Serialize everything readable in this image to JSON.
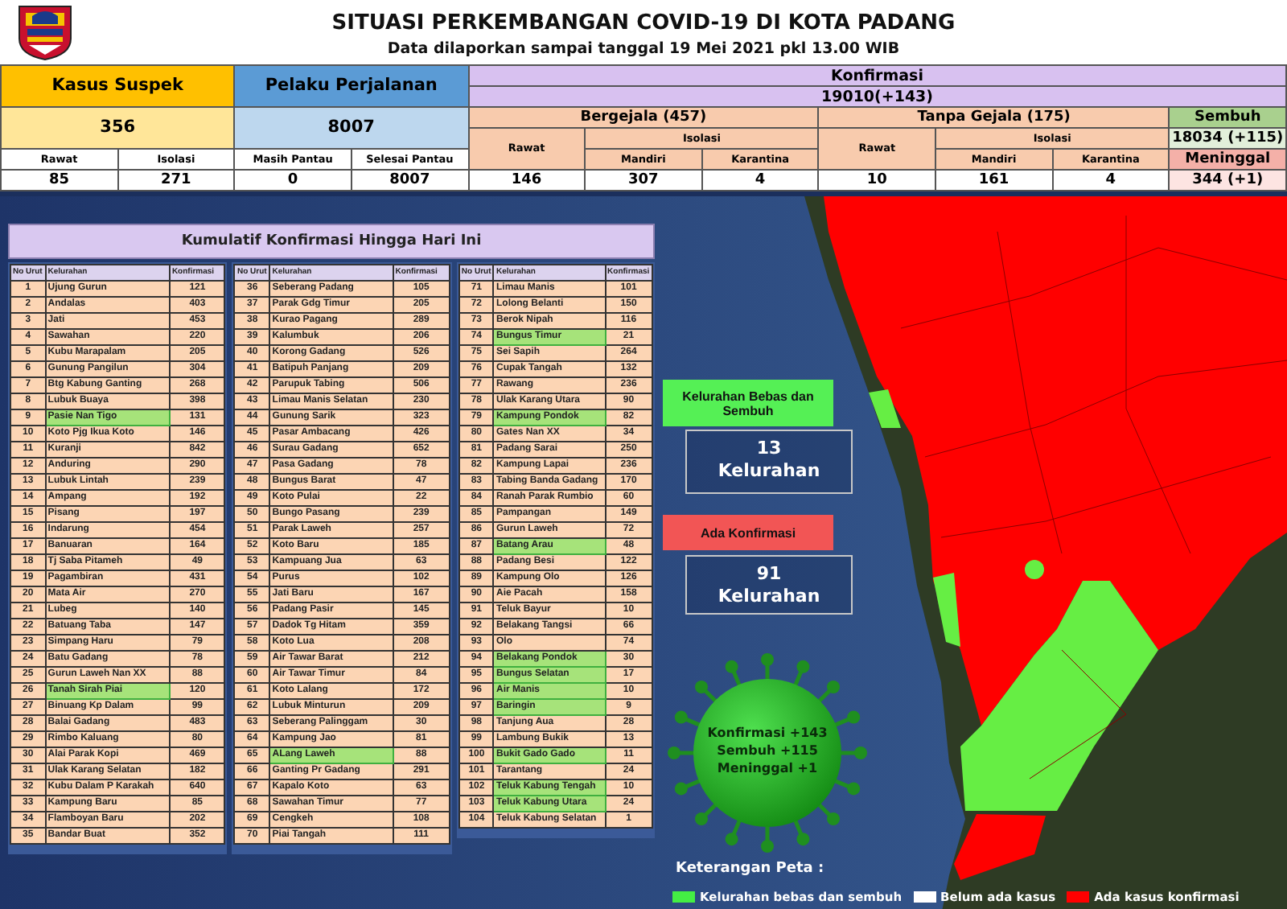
{
  "title": "SITUASI PERKEMBANGAN COVID-19 DI KOTA PADANG",
  "subtitle": "Data dilaporkan sampai tanggal 19 Mei 2021 pkl 13.00 WIB",
  "summary": {
    "suspect": {
      "label": "Kasus Suspek",
      "total": "356",
      "columns": [
        {
          "label": "Rawat",
          "value": "85"
        },
        {
          "label": "Isolasi",
          "value": "271"
        }
      ]
    },
    "travelers": {
      "label": "Pelaku Perjalanan",
      "total": "8007",
      "columns": [
        {
          "label": "Masih Pantau",
          "value": "0"
        },
        {
          "label": "Selesai Pantau",
          "value": "8007"
        }
      ]
    },
    "confirmed": {
      "label": "Konfirmasi",
      "total": "19010(+143)",
      "groups": [
        {
          "label": "Bergejala (457)",
          "care_label": "Rawat",
          "care": "146",
          "isolation_label": "Isolasi",
          "columns": [
            {
              "label": "Mandiri",
              "value": "307"
            },
            {
              "label": "Karantina",
              "value": "4"
            }
          ]
        },
        {
          "label": "Tanpa Gejala (175)",
          "care_label": "Rawat",
          "care": "10",
          "isolation_label": "Isolasi",
          "columns": [
            {
              "label": "Mandiri",
              "value": "161"
            },
            {
              "label": "Karantina",
              "value": "4"
            }
          ]
        }
      ],
      "recovered": {
        "label": "Sembuh",
        "value": "18034 (+115)"
      },
      "deaths": {
        "label": "Meninggal",
        "value": "344 (+1)"
      }
    }
  },
  "cumulative": {
    "title": "Kumulatif Konfirmasi Hingga Hari Ini",
    "tables": [
      {
        "columns": [
          "No Urut",
          "Kelurahan",
          "Konfirmasi"
        ],
        "rows": [
          {
            "no": "1",
            "name": "Ujung Gurun",
            "count": "121",
            "free": false
          },
          {
            "no": "2",
            "name": "Andalas",
            "count": "403",
            "free": false
          },
          {
            "no": "3",
            "name": "Jati",
            "count": "453",
            "free": false
          },
          {
            "no": "4",
            "name": "Sawahan",
            "count": "220",
            "free": false
          },
          {
            "no": "5",
            "name": "Kubu Marapalam",
            "count": "205",
            "free": false
          },
          {
            "no": "6",
            "name": "Gunung Pangilun",
            "count": "304",
            "free": false
          },
          {
            "no": "7",
            "name": "Btg Kabung Ganting",
            "count": "268",
            "free": false
          },
          {
            "no": "8",
            "name": "Lubuk Buaya",
            "count": "398",
            "free": false
          },
          {
            "no": "9",
            "name": "Pasie Nan Tigo",
            "count": "131",
            "free": true
          },
          {
            "no": "10",
            "name": "Koto Pjg Ikua Koto",
            "count": "146",
            "free": false
          },
          {
            "no": "11",
            "name": "Kuranji",
            "count": "842",
            "free": false
          },
          {
            "no": "12",
            "name": "Anduring",
            "count": "290",
            "free": false
          },
          {
            "no": "13",
            "name": "Lubuk Lintah",
            "count": "239",
            "free": false
          },
          {
            "no": "14",
            "name": "Ampang",
            "count": "192",
            "free": false
          },
          {
            "no": "15",
            "name": "Pisang",
            "count": "197",
            "free": false
          },
          {
            "no": "16",
            "name": "Indarung",
            "count": "454",
            "free": false
          },
          {
            "no": "17",
            "name": "Banuaran",
            "count": "164",
            "free": false
          },
          {
            "no": "18",
            "name": "Tj Saba Pitameh",
            "count": "49",
            "free": false
          },
          {
            "no": "19",
            "name": "Pagambiran",
            "count": "431",
            "free": false
          },
          {
            "no": "20",
            "name": "Mata Air",
            "count": "270",
            "free": false
          },
          {
            "no": "21",
            "name": "Lubeg",
            "count": "140",
            "free": false
          },
          {
            "no": "22",
            "name": "Batuang Taba",
            "count": "147",
            "free": false
          },
          {
            "no": "23",
            "name": "Simpang Haru",
            "count": "79",
            "free": false
          },
          {
            "no": "24",
            "name": "Batu Gadang",
            "count": "78",
            "free": false
          },
          {
            "no": "25",
            "name": "Gurun Laweh Nan XX",
            "count": "88",
            "free": false
          },
          {
            "no": "26",
            "name": "Tanah Sirah Piai",
            "count": "120",
            "free": true
          },
          {
            "no": "27",
            "name": "Binuang Kp Dalam",
            "count": "99",
            "free": false
          },
          {
            "no": "28",
            "name": "Balai Gadang",
            "count": "483",
            "free": false
          },
          {
            "no": "29",
            "name": "Rimbo Kaluang",
            "count": "80",
            "free": false
          },
          {
            "no": "30",
            "name": "Alai Parak Kopi",
            "count": "469",
            "free": false
          },
          {
            "no": "31",
            "name": "Ulak Karang Selatan",
            "count": "182",
            "free": false
          },
          {
            "no": "32",
            "name": "Kubu Dalam P Karakah",
            "count": "640",
            "free": false
          },
          {
            "no": "33",
            "name": "Kampung Baru",
            "count": "85",
            "free": false
          },
          {
            "no": "34",
            "name": "Flamboyan Baru",
            "count": "202",
            "free": false
          },
          {
            "no": "35",
            "name": "Bandar Buat",
            "count": "352",
            "free": false
          }
        ]
      },
      {
        "columns": [
          "No Urut",
          "Kelurahan",
          "Konfirmasi"
        ],
        "rows": [
          {
            "no": "36",
            "name": "Seberang Padang",
            "count": "105",
            "free": false
          },
          {
            "no": "37",
            "name": "Parak Gdg Timur",
            "count": "205",
            "free": false
          },
          {
            "no": "38",
            "name": "Kurao Pagang",
            "count": "289",
            "free": false
          },
          {
            "no": "39",
            "name": "Kalumbuk",
            "count": "206",
            "free": false
          },
          {
            "no": "40",
            "name": "Korong Gadang",
            "count": "526",
            "free": false
          },
          {
            "no": "41",
            "name": "Batipuh Panjang",
            "count": "209",
            "free": false
          },
          {
            "no": "42",
            "name": "Parupuk Tabing",
            "count": "506",
            "free": false
          },
          {
            "no": "43",
            "name": "Limau Manis Selatan",
            "count": "230",
            "free": false
          },
          {
            "no": "44",
            "name": "Gunung Sarik",
            "count": "323",
            "free": false
          },
          {
            "no": "45",
            "name": "Pasar Ambacang",
            "count": "426",
            "free": false
          },
          {
            "no": "46",
            "name": "Surau Gadang",
            "count": "652",
            "free": false
          },
          {
            "no": "47",
            "name": "Pasa Gadang",
            "count": "78",
            "free": false
          },
          {
            "no": "48",
            "name": "Bungus Barat",
            "count": "47",
            "free": false
          },
          {
            "no": "49",
            "name": "Koto Pulai",
            "count": "22",
            "free": false
          },
          {
            "no": "50",
            "name": "Bungo Pasang",
            "count": "239",
            "free": false
          },
          {
            "no": "51",
            "name": "Parak Laweh",
            "count": "257",
            "free": false
          },
          {
            "no": "52",
            "name": "Koto Baru",
            "count": "185",
            "free": false
          },
          {
            "no": "53",
            "name": "Kampuang Jua",
            "count": "63",
            "free": false
          },
          {
            "no": "54",
            "name": "Purus",
            "count": "102",
            "free": false
          },
          {
            "no": "55",
            "name": "Jati Baru",
            "count": "167",
            "free": false
          },
          {
            "no": "56",
            "name": "Padang Pasir",
            "count": "145",
            "free": false
          },
          {
            "no": "57",
            "name": "Dadok Tg Hitam",
            "count": "359",
            "free": false
          },
          {
            "no": "58",
            "name": "Koto Lua",
            "count": "208",
            "free": false
          },
          {
            "no": "59",
            "name": "Air Tawar Barat",
            "count": "212",
            "free": false
          },
          {
            "no": "60",
            "name": "Air Tawar Timur",
            "count": "84",
            "free": false
          },
          {
            "no": "61",
            "name": "Koto Lalang",
            "count": "172",
            "free": false
          },
          {
            "no": "62",
            "name": "Lubuk Minturun",
            "count": "209",
            "free": false
          },
          {
            "no": "63",
            "name": "Seberang Palinggam",
            "count": "30",
            "free": false
          },
          {
            "no": "64",
            "name": "Kampung Jao",
            "count": "81",
            "free": false
          },
          {
            "no": "65",
            "name": "ALang Laweh",
            "count": "88",
            "free": true
          },
          {
            "no": "66",
            "name": "Ganting Pr Gadang",
            "count": "291",
            "free": false
          },
          {
            "no": "67",
            "name": "Kapalo Koto",
            "count": "63",
            "free": false
          },
          {
            "no": "68",
            "name": "Sawahan Timur",
            "count": "77",
            "free": false
          },
          {
            "no": "69",
            "name": "Cengkeh",
            "count": "108",
            "free": false
          },
          {
            "no": "70",
            "name": "Piai Tangah",
            "count": "111",
            "free": false
          }
        ]
      },
      {
        "columns": [
          "No Urut",
          "Kelurahan",
          "Konfirmasi"
        ],
        "rows": [
          {
            "no": "71",
            "name": "Limau Manis",
            "count": "101",
            "free": false
          },
          {
            "no": "72",
            "name": "Lolong Belanti",
            "count": "150",
            "free": false
          },
          {
            "no": "73",
            "name": "Berok Nipah",
            "count": "116",
            "free": false
          },
          {
            "no": "74",
            "name": "Bungus Timur",
            "count": "21",
            "free": true
          },
          {
            "no": "75",
            "name": "Sei Sapih",
            "count": "264",
            "free": false
          },
          {
            "no": "76",
            "name": "Cupak Tangah",
            "count": "132",
            "free": false
          },
          {
            "no": "77",
            "name": "Rawang",
            "count": "236",
            "free": false
          },
          {
            "no": "78",
            "name": "Ulak Karang Utara",
            "count": "90",
            "free": false
          },
          {
            "no": "79",
            "name": "Kampung Pondok",
            "count": "82",
            "free": true
          },
          {
            "no": "80",
            "name": "Gates Nan XX",
            "count": "34",
            "free": false
          },
          {
            "no": "81",
            "name": "Padang Sarai",
            "count": "250",
            "free": false
          },
          {
            "no": "82",
            "name": "Kampung Lapai",
            "count": "236",
            "free": false
          },
          {
            "no": "83",
            "name": "Tabing Banda Gadang",
            "count": "170",
            "free": false
          },
          {
            "no": "84",
            "name": "Ranah Parak Rumbio",
            "count": "60",
            "free": false
          },
          {
            "no": "85",
            "name": "Pampangan",
            "count": "149",
            "free": false
          },
          {
            "no": "86",
            "name": "Gurun Laweh",
            "count": "72",
            "free": false
          },
          {
            "no": "87",
            "name": "Batang Arau",
            "count": "48",
            "free": true
          },
          {
            "no": "88",
            "name": "Padang Besi",
            "count": "122",
            "free": false
          },
          {
            "no": "89",
            "name": "Kampung Olo",
            "count": "126",
            "free": false
          },
          {
            "no": "90",
            "name": "Aie Pacah",
            "count": "158",
            "free": false
          },
          {
            "no": "91",
            "name": "Teluk Bayur",
            "count": "10",
            "free": false
          },
          {
            "no": "92",
            "name": "Belakang Tangsi",
            "count": "66",
            "free": false
          },
          {
            "no": "93",
            "name": "Olo",
            "count": "74",
            "free": false
          },
          {
            "no": "94",
            "name": "Belakang Pondok",
            "count": "30",
            "free": true
          },
          {
            "no": "95",
            "name": "Bungus Selatan",
            "count": "17",
            "free": true
          },
          {
            "no": "96",
            "name": "Air Manis",
            "count": "10",
            "free": true
          },
          {
            "no": "97",
            "name": "Baringin",
            "count": "9",
            "free": true
          },
          {
            "no": "98",
            "name": "Tanjung Aua",
            "count": "28",
            "free": false
          },
          {
            "no": "99",
            "name": "Lambung Bukik",
            "count": "13",
            "free": false
          },
          {
            "no": "100",
            "name": "Bukit Gado Gado",
            "count": "11",
            "free": true
          },
          {
            "no": "101",
            "name": "Tarantang",
            "count": "24",
            "free": false
          },
          {
            "no": "102",
            "name": "Teluk Kabung Tengah",
            "count": "10",
            "free": true
          },
          {
            "no": "103",
            "name": "Teluk Kabung Utara",
            "count": "24",
            "free": true
          },
          {
            "no": "104",
            "name": "Teluk Kabung Selatan",
            "count": "1",
            "free": false
          }
        ]
      }
    ]
  },
  "map": {
    "free_label": "Kelurahan Bebas dan Sembuh",
    "free_count": "13",
    "free_unit": "Kelurahan",
    "confirmed_label": "Ada Konfirmasi",
    "confirmed_count": "91",
    "confirmed_unit": "Kelurahan",
    "virus_lines": [
      "Konfirmasi +143",
      "Sembuh +115",
      "Meninggal +1"
    ],
    "legend_title": "Keterangan Peta :",
    "legend": [
      {
        "label": "Kelurahan bebas dan sembuh",
        "color": "#44ee44"
      },
      {
        "label": "Belum ada kasus",
        "color": "#ffffff"
      },
      {
        "label": "Ada kasus konfirmasi",
        "color": "#ff0000"
      }
    ]
  }
}
